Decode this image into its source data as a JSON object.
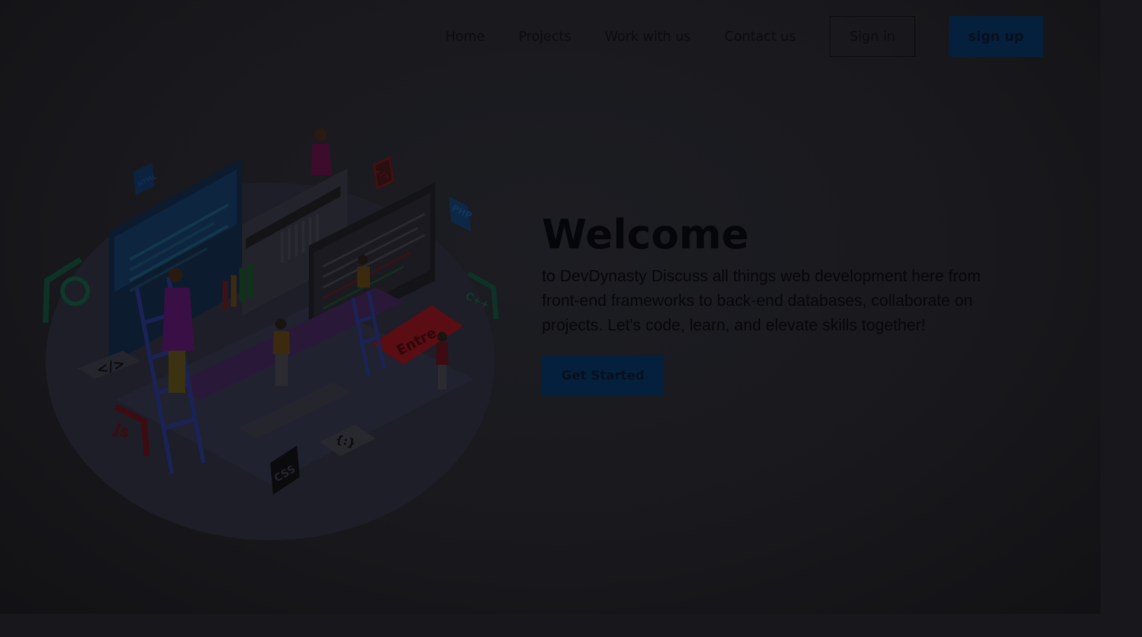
{
  "nav": {
    "links": [
      "Home",
      "Projects",
      "Work with us",
      "Contact us"
    ],
    "signin_label": "Sign in",
    "signup_label": "sign up"
  },
  "hero": {
    "title": "Welcome",
    "description": "to DevDynasty Discuss all things web development here from front-end frameworks to back-end databases, collaborate on projects. Let's code, learn, and elevate skills together!",
    "cta_label": "Get Started"
  },
  "illustration": {
    "badges": {
      "html": "HTML",
      "code": "</>",
      "php": "PHP",
      "cpp": "C++",
      "js": "Js",
      "css": "CSS",
      "tag": "</>",
      "braces": "{:}",
      "entre": "Entre"
    }
  },
  "colors": {
    "background": "#18181c",
    "primary_button": "#04203d",
    "text": "#0c0c10"
  }
}
